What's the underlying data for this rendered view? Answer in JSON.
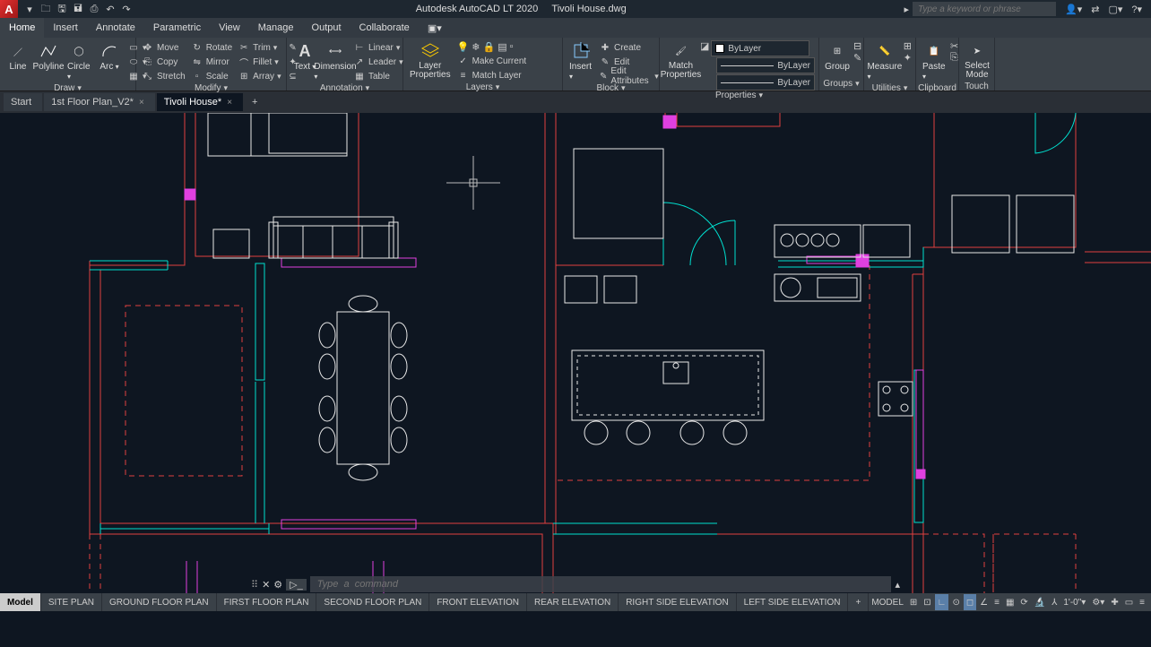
{
  "title": {
    "app": "Autodesk AutoCAD LT 2020",
    "file": "Tivoli House.dwg"
  },
  "search_placeholder": "Type a keyword or phrase",
  "menus": [
    "Home",
    "Insert",
    "Annotate",
    "Parametric",
    "View",
    "Manage",
    "Output",
    "Collaborate"
  ],
  "active_menu": "Home",
  "file_tabs": [
    {
      "label": "Start",
      "close": false
    },
    {
      "label": "1st Floor Plan_V2*",
      "close": true
    },
    {
      "label": "Tivoli House*",
      "close": true
    }
  ],
  "active_file_tab": 2,
  "ribbon": {
    "draw": {
      "label": "Draw",
      "line": "Line",
      "polyline": "Polyline",
      "circle": "Circle",
      "arc": "Arc"
    },
    "modify": {
      "label": "Modify",
      "move": "Move",
      "rotate": "Rotate",
      "trim": "Trim",
      "copy": "Copy",
      "mirror": "Mirror",
      "fillet": "Fillet",
      "stretch": "Stretch",
      "scale": "Scale",
      "array": "Array"
    },
    "annotation": {
      "label": "Annotation",
      "text": "Text",
      "dimension": "Dimension",
      "linear": "Linear",
      "leader": "Leader",
      "table": "Table"
    },
    "layers": {
      "label": "Layers",
      "layer_properties": "Layer\nProperties",
      "make_current": "Make Current",
      "match_layer": "Match Layer"
    },
    "block": {
      "label": "Block",
      "insert": "Insert",
      "create": "Create",
      "edit": "Edit",
      "edit_attributes": "Edit Attributes"
    },
    "properties": {
      "label": "Properties",
      "match": "Match\nProperties",
      "bylayer": "ByLayer"
    },
    "groups": {
      "label": "Groups",
      "group": "Group"
    },
    "utilities": {
      "label": "Utilities",
      "measure": "Measure"
    },
    "clipboard": {
      "label": "Clipboard",
      "paste": "Paste"
    },
    "touch": {
      "label": "Touch",
      "select": "Select\nMode"
    }
  },
  "command_placeholder": "Type  a  command",
  "layout_tabs": [
    "Model",
    "SITE PLAN",
    "GROUND FLOOR PLAN",
    "FIRST FLOOR PLAN",
    "SECOND FLOOR PLAN",
    "FRONT  ELEVATION",
    "REAR  ELEVATION",
    "RIGHT SIDE ELEVATION",
    "LEFT SIDE  ELEVATION"
  ],
  "active_layout": 0,
  "status": {
    "model": "MODEL",
    "scale": "1'-0\""
  },
  "colors": {
    "wall": "#e04040",
    "window": "#00e0d0",
    "door_swing": "#00e0d0",
    "header": "#e040e0",
    "furniture": "#ffffff",
    "dashed": "#e04040"
  }
}
